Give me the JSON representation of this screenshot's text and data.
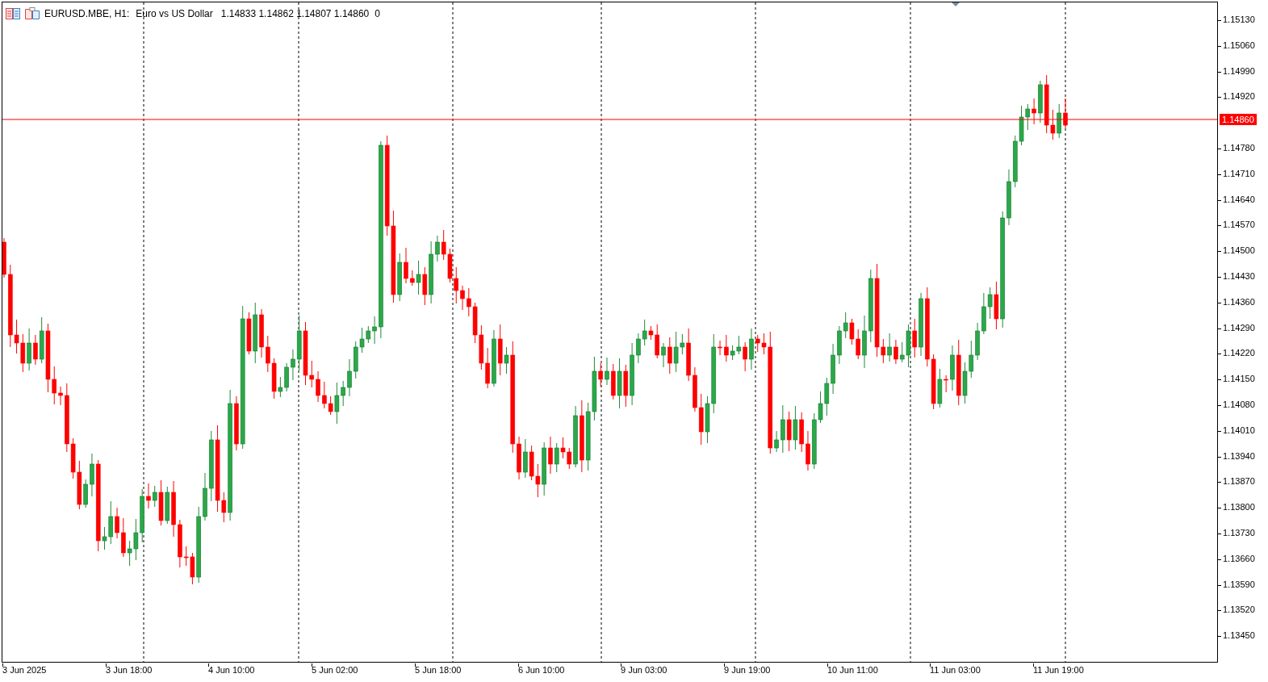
{
  "chart_header": {
    "symbol": "EURUSD.MBE, H1:",
    "description": "Euro vs US Dollar",
    "ohlc": "1.14833 1.14862 1.14807 1.14860",
    "volume": "0"
  },
  "price_line": {
    "label": "1.14860"
  },
  "price_axis": [
    "1.15130",
    "1.15060",
    "1.14990",
    "1.14920",
    "1.14780",
    "1.14710",
    "1.14640",
    "1.14570",
    "1.14500",
    "1.14430",
    "1.14360",
    "1.14290",
    "1.14220",
    "1.14150",
    "1.14080",
    "1.14010",
    "1.13940",
    "1.13870",
    "1.13800",
    "1.13730",
    "1.13660",
    "1.13590",
    "1.13520",
    "1.13450"
  ],
  "time_axis": [
    "3 Jun 2025",
    "3 Jun 18:00",
    "4 Jun 10:00",
    "5 Jun 02:00",
    "5 Jun 18:00",
    "6 Jun 10:00",
    "9 Jun 03:00",
    "9 Jun 19:00",
    "10 Jun 11:00",
    "11 Jun 03:00",
    "11 Jun 19:00"
  ]
}
